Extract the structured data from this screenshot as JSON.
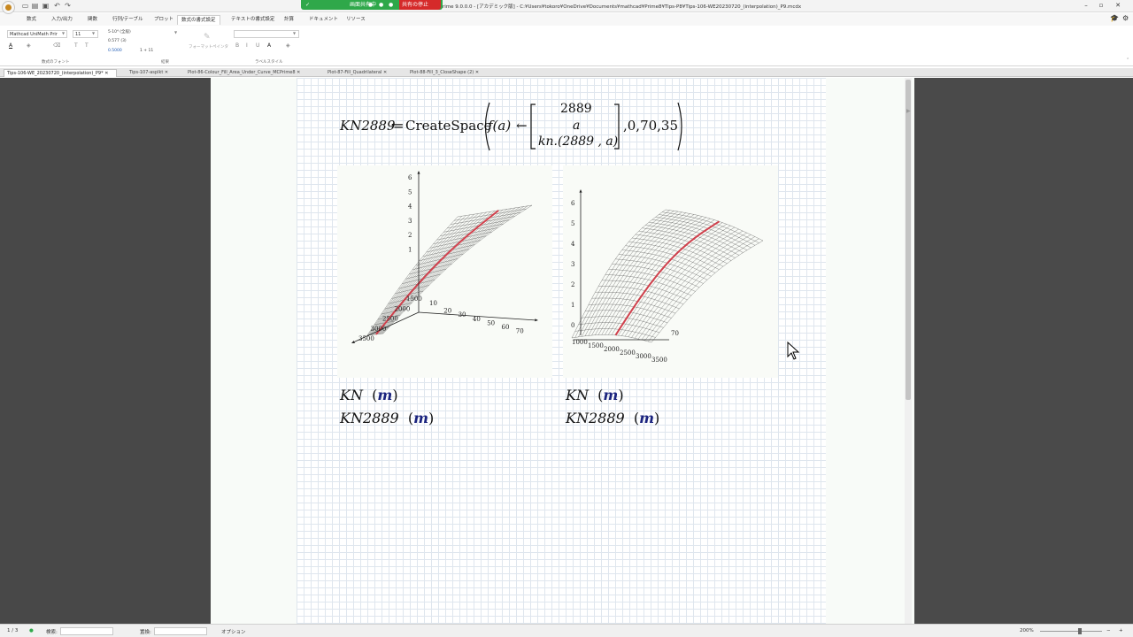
{
  "titlebar": {
    "share_status": "画面共有中",
    "stop_share": "共有の停止",
    "window_title": "rime 9.0.0.0 - [アカデミック版] - C:¥Users¥tokoro¥OneDrive¥Documents¥mathcad¥Prime8¥Tips-P8¥Tips-106-WE20230720_(interpolation)_P9.mcdx"
  },
  "ribbon": {
    "tabs": [
      "数式",
      "入力/出力",
      "関数",
      "行列/テーブル",
      "プロット",
      "数式の書式設定",
      "テキストの書式設定",
      "計算",
      "ドキュメント",
      "リソース"
    ],
    "active_tab": 5,
    "font_name": "Mathcad UniMath Prir",
    "font_size": "11",
    "number_format": "5·10⁴ (全般)",
    "precision": "0.577 (3)",
    "sample_value": "0.5000",
    "sample_expr": "1 + 11",
    "format_painter": "フォーマットペインタ",
    "group_font": "数式のフォント",
    "group_result": "結果",
    "group_label_style": "ラベルスタイル"
  },
  "doc_tabs": [
    {
      "label": "Tips-106-WE_20230720_(interpolation)_P9*",
      "active": true
    },
    {
      "label": "Tips-107-asplkt",
      "active": false
    },
    {
      "label": "Plot-86-Colour_Fill_Area_Under_Curve_MCPrime8",
      "active": false
    },
    {
      "label": "Plot-87-Fill_Quadrilateral",
      "active": false
    },
    {
      "label": "Plot-88-Fill_3_CloseShape (2)",
      "active": false
    }
  ],
  "worksheet": {
    "def_name": "KN2889",
    "assign": "≔",
    "func": "CreateSpace",
    "lambda_head": "f(a)",
    "arrow": "←",
    "vec_row1": "2889",
    "vec_row2": "a",
    "vec_row3": "kn.(2889 , a)",
    "args": ",0,70,35",
    "axis_labels_left": {
      "z": [
        "6",
        "5",
        "4",
        "3",
        "2",
        "1"
      ],
      "x": [
        "10",
        "20",
        "30",
        "40",
        "50",
        "60",
        "70"
      ],
      "y": [
        "1500",
        "2000",
        "2500",
        "3000",
        "3500"
      ]
    },
    "axis_labels_right": {
      "z": [
        "6",
        "5",
        "4",
        "3",
        "2",
        "1",
        "0"
      ],
      "y": [
        "1000",
        "1500",
        "2000",
        "2500",
        "3000",
        "3500"
      ],
      "x": [
        "70"
      ]
    },
    "left_label_1": "KN",
    "left_label_2": "KN2889",
    "right_label_1": "KN",
    "right_label_2": "KN2889",
    "arg_m": "m"
  },
  "statusbar": {
    "page": "1 / 3",
    "search_label": "検索:",
    "replace_label": "置換:",
    "options_label": "オプション",
    "zoom": "200%"
  },
  "colors": {
    "surface_edge": "#2b2b2b",
    "highlight_curve": "#d1414d",
    "accent_green": "#2fa84a",
    "stop_red": "#d52a2a"
  }
}
